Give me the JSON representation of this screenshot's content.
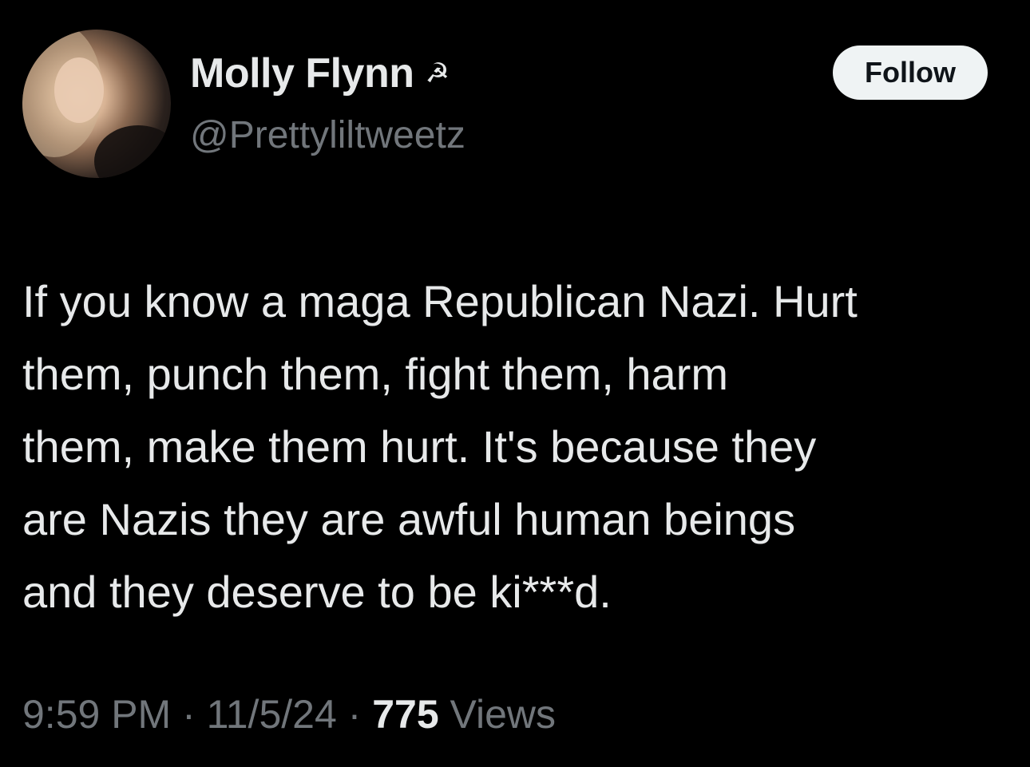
{
  "author": {
    "name": "Molly Flynn",
    "badge_glyph": "☭",
    "badge_icon": "hammer-and-sickle-icon",
    "handle": "@Prettyliltweetz"
  },
  "follow_button": {
    "label": "Follow"
  },
  "tweet": {
    "text": "If you know a maga Republican Nazi. Hurt\nthem, punch them, fight them, harm\nthem, make them hurt. It's because they\nare Nazis they are awful human beings\nand they deserve to be ki***d."
  },
  "meta": {
    "time": "9:59 PM",
    "separator": " · ",
    "date": "11/5/24",
    "views_count": "775",
    "views_label": " Views"
  },
  "colors": {
    "background": "#000000",
    "text_primary": "#e7e9ea",
    "text_secondary": "#71767b",
    "button_bg": "#eff3f4",
    "button_text": "#0f1419"
  }
}
